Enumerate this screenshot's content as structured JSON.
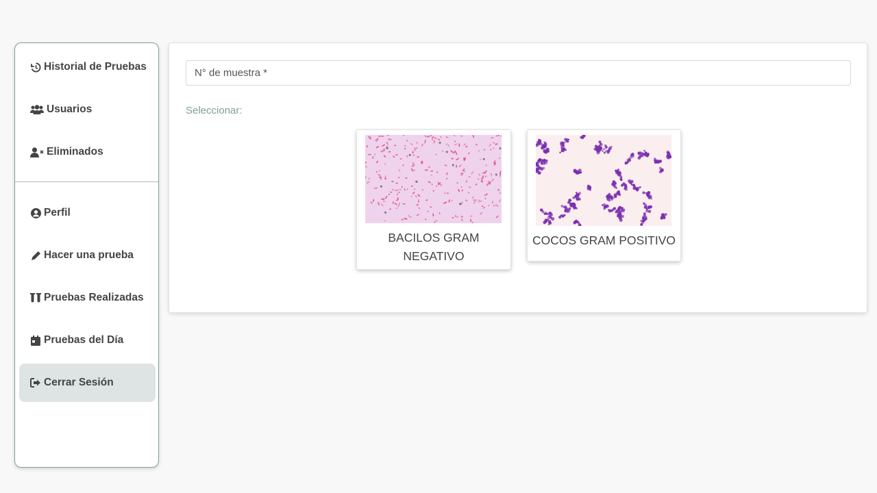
{
  "sidebar": {
    "items": [
      {
        "label": "Historial de Pruebas",
        "icon": "history-icon"
      },
      {
        "label": "Usuarios",
        "icon": "users-icon"
      },
      {
        "label": "Eliminados",
        "icon": "user-xmark-icon"
      },
      {
        "label": "Perfil",
        "icon": "user-circle-icon"
      },
      {
        "label": "Hacer una prueba",
        "icon": "pen-icon"
      },
      {
        "label": "Pruebas Realizadas",
        "icon": "vials-icon"
      },
      {
        "label": "Pruebas del Día",
        "icon": "calendar-icon"
      },
      {
        "label": "Cerrar Sesión",
        "icon": "sign-out-icon"
      }
    ],
    "active_item": "Cerrar Sesión"
  },
  "main": {
    "sample_input": {
      "placeholder": "N° de muestra *",
      "value": ""
    },
    "select_label": "Seleccionar:",
    "options": [
      {
        "label": "BACILOS GRAM NEGATIVO",
        "image": "gram-negative-bacilli-micrograph"
      },
      {
        "label": "COCOS GRAM POSITIVO",
        "image": "gram-positive-cocci-micrograph"
      }
    ]
  },
  "colors": {
    "page_background": "#f8f8f8",
    "sidebar_border": "#7f9f97",
    "active_item_background": "#dde4e3",
    "accent_text": "#7f9f97",
    "negative_stain": "#e2498a",
    "positive_stain": "#7a2fb0"
  }
}
